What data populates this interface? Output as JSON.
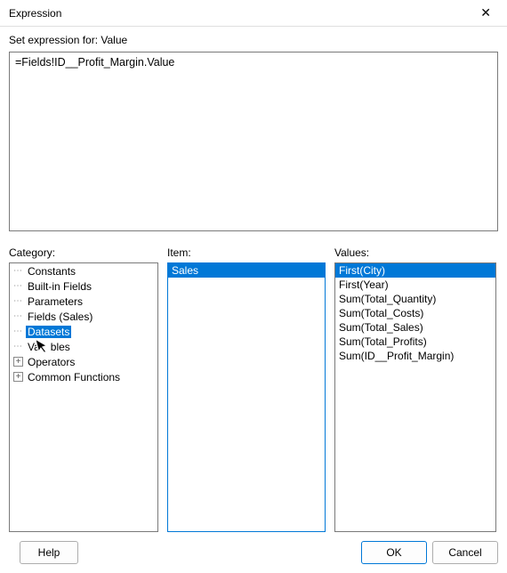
{
  "window": {
    "title": "Expression"
  },
  "header": {
    "set_expression_label": "Set expression for: Value"
  },
  "expression": {
    "text": "=Fields!ID__Profit_Margin.Value"
  },
  "labels": {
    "category": "Category:",
    "item": "Item:",
    "values": "Values:"
  },
  "category_tree": [
    {
      "label": "Constants",
      "expandable": false
    },
    {
      "label": "Built-in Fields",
      "expandable": false
    },
    {
      "label": "Parameters",
      "expandable": false
    },
    {
      "label": "Fields (Sales)",
      "expandable": false
    },
    {
      "label": "Datasets",
      "expandable": false,
      "selected": true
    },
    {
      "label": "Variables",
      "expandable": false,
      "cursor": true
    },
    {
      "label": "Operators",
      "expandable": true
    },
    {
      "label": "Common Functions",
      "expandable": true
    }
  ],
  "item_list": [
    {
      "label": "Sales",
      "selected": true
    }
  ],
  "values_list": [
    {
      "label": "First(City)",
      "selected": true
    },
    {
      "label": "First(Year)",
      "selected": false
    },
    {
      "label": "Sum(Total_Quantity)",
      "selected": false
    },
    {
      "label": "Sum(Total_Costs)",
      "selected": false
    },
    {
      "label": "Sum(Total_Sales)",
      "selected": false
    },
    {
      "label": "Sum(Total_Profits)",
      "selected": false
    },
    {
      "label": "Sum(ID__Profit_Margin)",
      "selected": false
    }
  ],
  "buttons": {
    "help": "Help",
    "ok": "OK",
    "cancel": "Cancel"
  }
}
